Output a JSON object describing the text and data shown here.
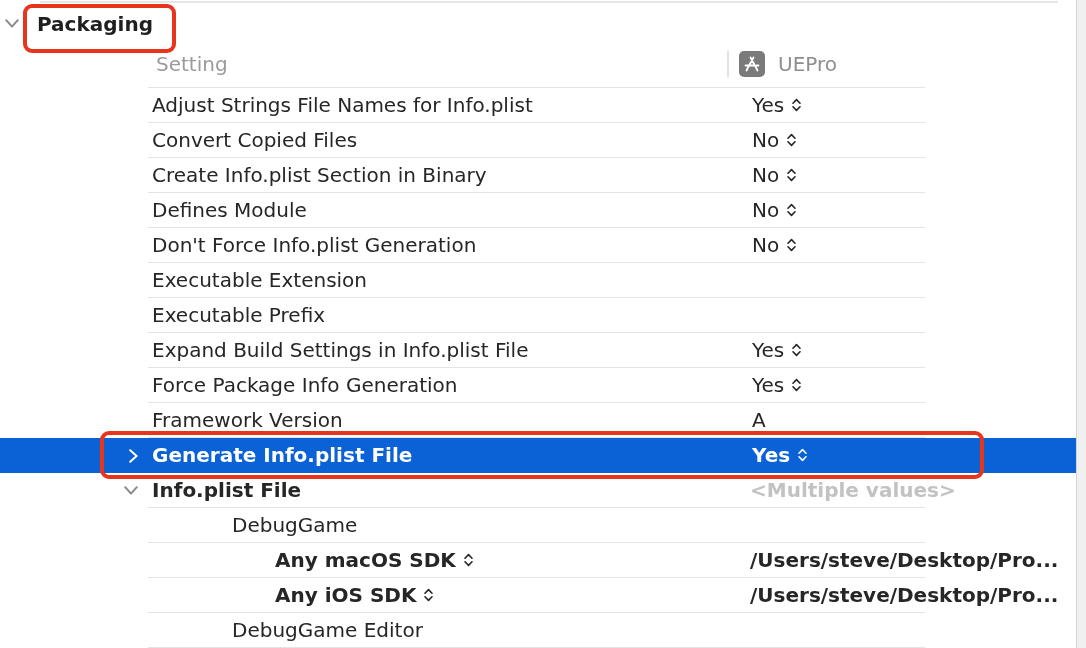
{
  "section": {
    "title": "Packaging",
    "expanded": true,
    "highlighted": true
  },
  "columns": [
    {
      "label": "Setting"
    },
    {
      "label": "UEPro"
    }
  ],
  "rows": [
    {
      "name": "Adjust Strings File Names for Info.plist",
      "value": "Yes",
      "kind": "popup",
      "modified": false,
      "selected": false,
      "highlighted": false
    },
    {
      "name": "Convert Copied Files",
      "value": "No",
      "kind": "popup",
      "modified": false,
      "selected": false,
      "highlighted": false
    },
    {
      "name": "Create Info.plist Section in Binary",
      "value": "No",
      "kind": "popup",
      "modified": false,
      "selected": false,
      "highlighted": false
    },
    {
      "name": "Defines Module",
      "value": "No",
      "kind": "popup",
      "modified": false,
      "selected": false,
      "highlighted": false
    },
    {
      "name": "Don't Force Info.plist Generation",
      "value": "No",
      "kind": "popup",
      "modified": false,
      "selected": false,
      "highlighted": false
    },
    {
      "name": "Executable Extension",
      "kind": "text",
      "modified": false,
      "selected": false,
      "highlighted": false
    },
    {
      "name": "Executable Prefix",
      "kind": "text",
      "modified": false,
      "selected": false,
      "highlighted": false
    },
    {
      "name": "Expand Build Settings in Info.plist File",
      "value": "Yes",
      "kind": "popup",
      "modified": false,
      "selected": false,
      "highlighted": false
    },
    {
      "name": "Force Package Info Generation",
      "value": "Yes",
      "kind": "popup",
      "modified": false,
      "selected": false,
      "highlighted": false
    },
    {
      "name": "Framework Version",
      "value": "A",
      "kind": "text",
      "modified": false,
      "selected": false,
      "highlighted": false
    },
    {
      "name": "Generate Info.plist File",
      "value": "Yes",
      "kind": "popup",
      "modified": true,
      "selected": true,
      "highlighted": true,
      "expanded": false
    },
    {
      "name": "Info.plist File",
      "value": "<Multiple values>",
      "kind": "multiple",
      "modified": true,
      "selected": false,
      "highlighted": false,
      "expanded": true,
      "children": [
        {
          "name": "DebugGame",
          "kind": "config",
          "modified": false,
          "selected": false,
          "highlighted": false,
          "children": [
            {
              "name": "Any macOS SDK",
              "value": "/Users/steve/Desktop/Pro...",
              "kind": "condition",
              "modified": true,
              "selected": false,
              "highlighted": false
            },
            {
              "name": "Any iOS SDK",
              "value": "/Users/steve/Desktop/Pro...",
              "kind": "condition",
              "modified": true,
              "selected": false,
              "highlighted": false
            }
          ]
        },
        {
          "name": "DebugGame Editor",
          "kind": "config",
          "modified": false,
          "selected": false,
          "highlighted": false
        }
      ]
    }
  ]
}
